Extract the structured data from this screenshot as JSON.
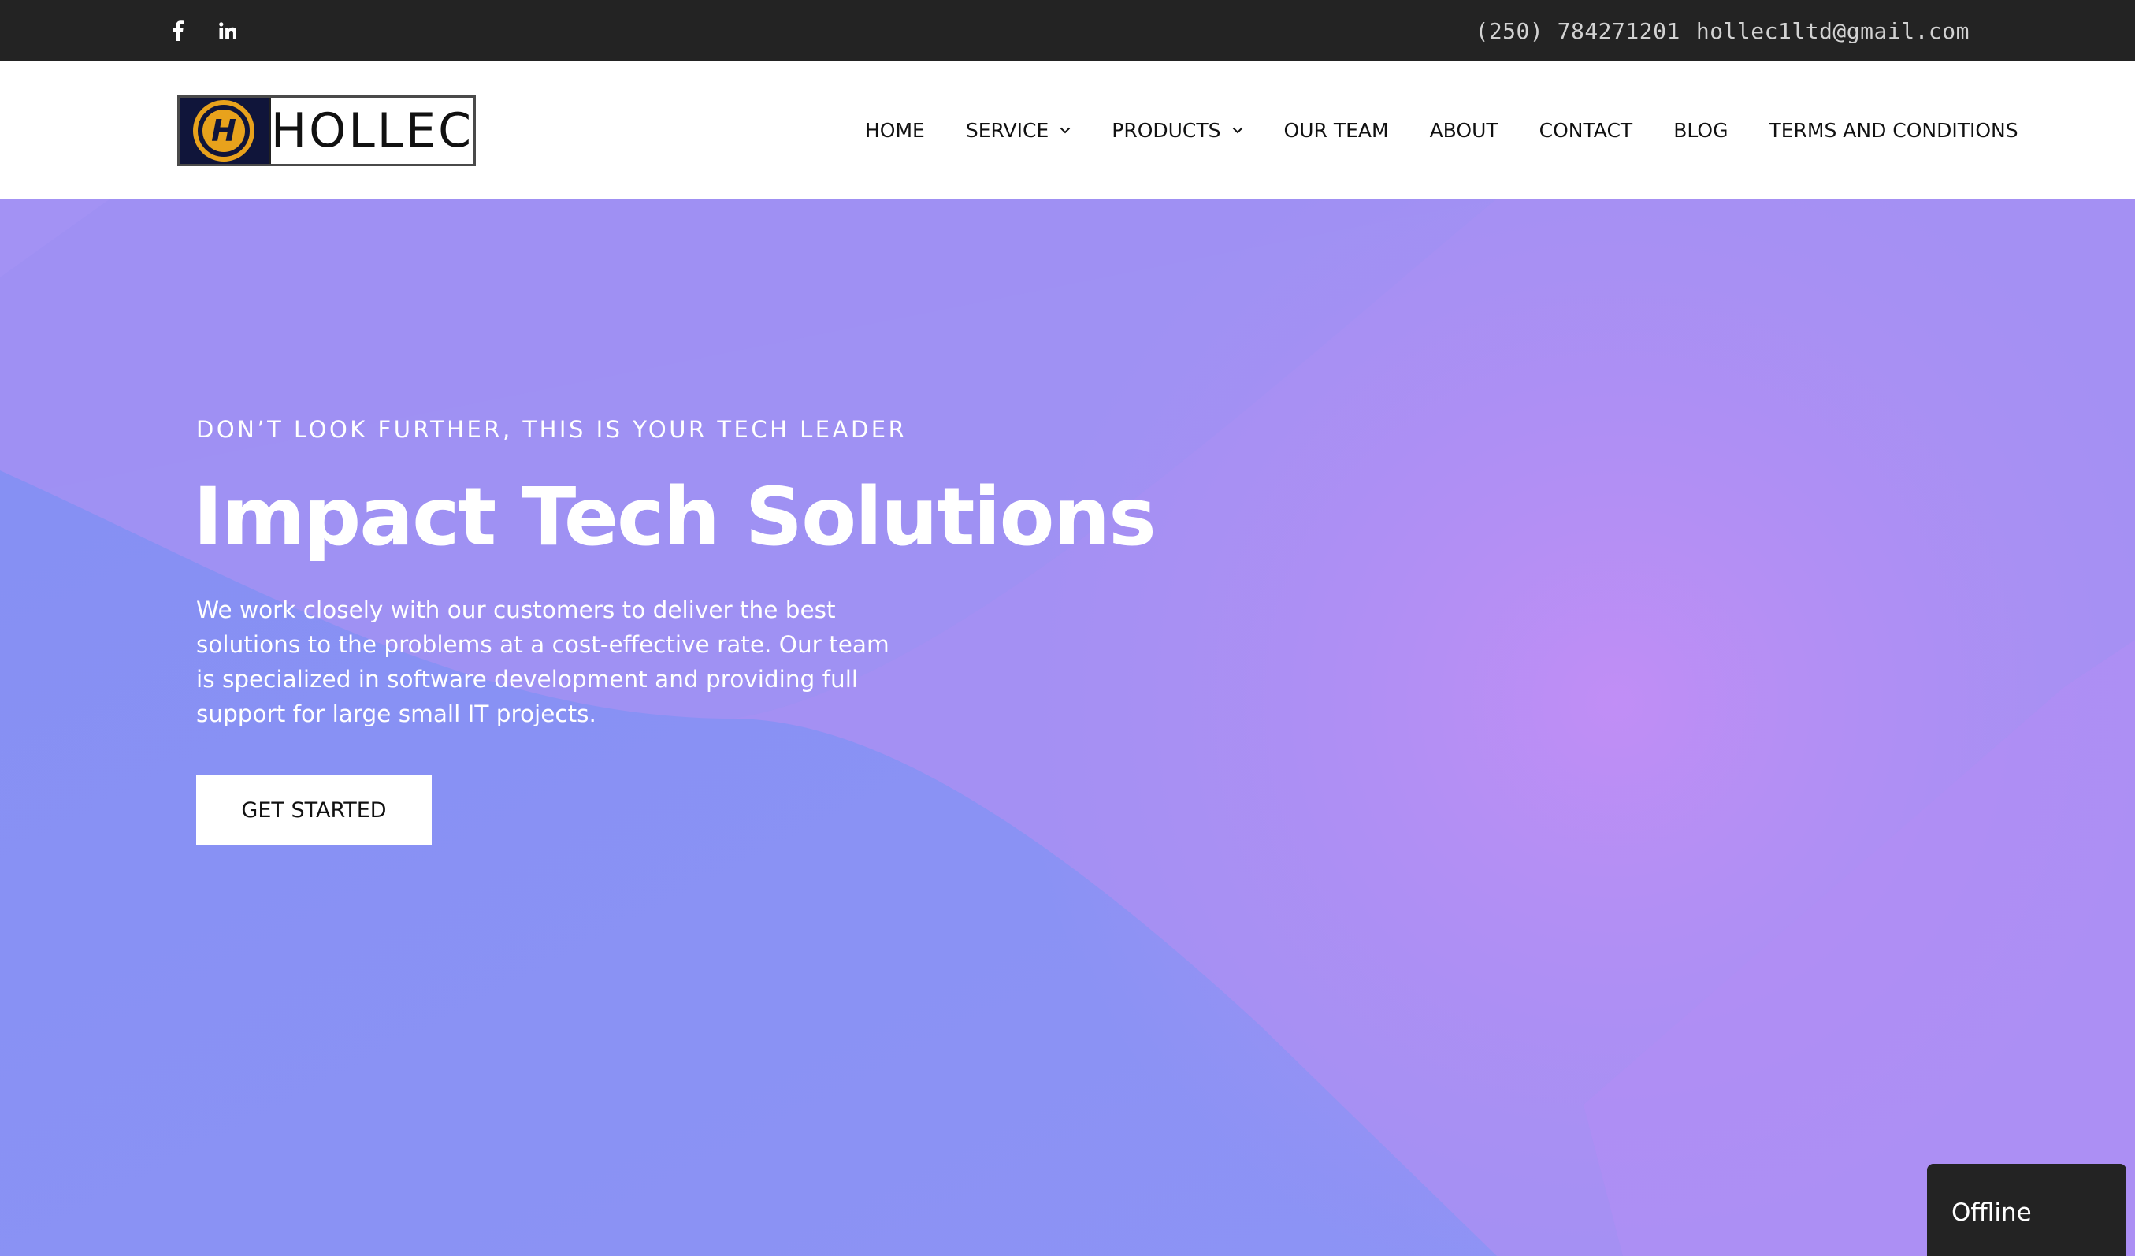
{
  "topbar": {
    "social": [
      {
        "name": "facebook-icon"
      },
      {
        "name": "linkedin-icon"
      }
    ],
    "phone": "(250) 784271201",
    "email": "hollec1ltd@gmail.com"
  },
  "header": {
    "logo": {
      "mark_letter": "H",
      "text": "HOLLEC",
      "mark_color": "#e8a21c",
      "mark_bg": "#10153a"
    },
    "nav": [
      {
        "label": "HOME",
        "dropdown": false
      },
      {
        "label": "SERVICE",
        "dropdown": true
      },
      {
        "label": "PRODUCTS",
        "dropdown": true
      },
      {
        "label": "OUR TEAM",
        "dropdown": false
      },
      {
        "label": "ABOUT",
        "dropdown": false
      },
      {
        "label": "CONTACT",
        "dropdown": false
      },
      {
        "label": "BLOG",
        "dropdown": false
      },
      {
        "label": "TERMS AND CONDITIONS",
        "dropdown": false
      }
    ]
  },
  "hero": {
    "eyebrow": "DON’T LOOK FURTHER, THIS IS YOUR TECH LEADER",
    "title": "Impact Tech Solutions",
    "description": "We work closely with our customers to deliver the best solutions to the problems at a cost-effective rate. Our team is specialized in software development and providing full support for large small IT projects.",
    "cta_label": "GET STARTED",
    "gradient_colors": [
      "#8c90f4",
      "#a08cf3",
      "#b690f3"
    ]
  },
  "chat": {
    "status": "Offline"
  }
}
